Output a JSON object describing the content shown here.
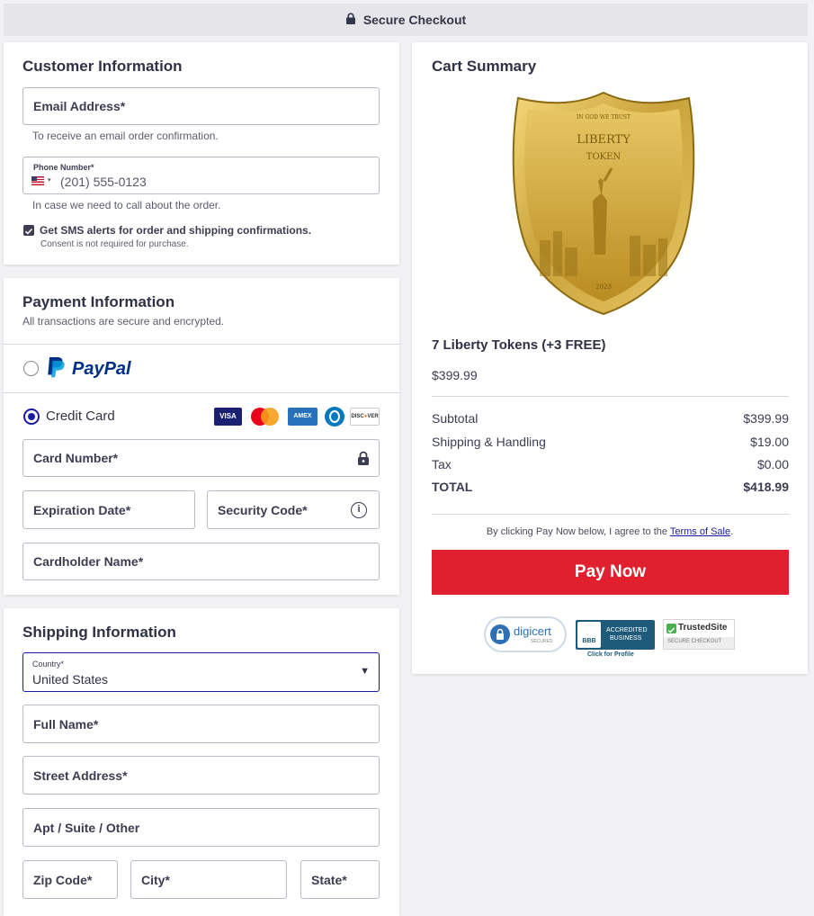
{
  "header": {
    "title": "Secure Checkout"
  },
  "customer": {
    "title": "Customer Information",
    "email_label": "Email Address*",
    "email_help": "To receive an email order confirmation.",
    "phone_label": "Phone Number*",
    "phone_placeholder": "(201) 555-0123",
    "phone_help": "In case we need to call about the order.",
    "sms_label": "Get SMS alerts for order and shipping confirmations.",
    "sms_note": "Consent is not required for purchase.",
    "sms_checked": true
  },
  "payment": {
    "title": "Payment Information",
    "subtitle": "All transactions are secure and encrypted.",
    "paypal_label": "PayPal",
    "credit_label": "Credit Card",
    "card_brands": [
      "VISA",
      "Mastercard",
      "AMEX",
      "Diners",
      "DISCOVER"
    ],
    "card_number_label": "Card Number*",
    "expiration_label": "Expiration Date*",
    "security_label": "Security Code*",
    "cardholder_label": "Cardholder Name*"
  },
  "shipping": {
    "title": "Shipping Information",
    "country_label": "Country*",
    "country_value": "United States",
    "fullname_label": "Full Name*",
    "street_label": "Street Address*",
    "apt_label": "Apt / Suite / Other",
    "zip_label": "Zip Code*",
    "city_label": "City*",
    "state_label": "State*"
  },
  "cart": {
    "title": "Cart Summary",
    "product_image_text": [
      "IN GOD WE TRUST",
      "LIBERTY",
      "TOKEN",
      "2023"
    ],
    "product_name": "7 Liberty Tokens (+3 FREE)",
    "product_price": "$399.99",
    "lines": [
      {
        "label": "Subtotal",
        "value": "$399.99"
      },
      {
        "label": "Shipping & Handling",
        "value": "$19.00"
      },
      {
        "label": "Tax",
        "value": "$0.00"
      }
    ],
    "total_label": "TOTAL",
    "total_value": "$418.99",
    "terms_prefix": "By clicking Pay Now below, I agree to the ",
    "terms_link": "Terms of Sale",
    "terms_suffix": ".",
    "pay_button": "Pay Now"
  },
  "badges": {
    "digicert": "digicert",
    "digicert_sub": "SECURED",
    "bbb_line1": "ACCREDITED",
    "bbb_line2": "BUSINESS",
    "bbb_logo": "BBB",
    "bbb_click": "Click for Profile",
    "trusted": "TrustedSite",
    "trusted_sub": "SECURE CHECKOUT"
  },
  "colors": {
    "accent": "#1a1aa6",
    "pay_button": "#e0202e",
    "paypal_dark": "#003087",
    "paypal_light": "#009cde"
  }
}
